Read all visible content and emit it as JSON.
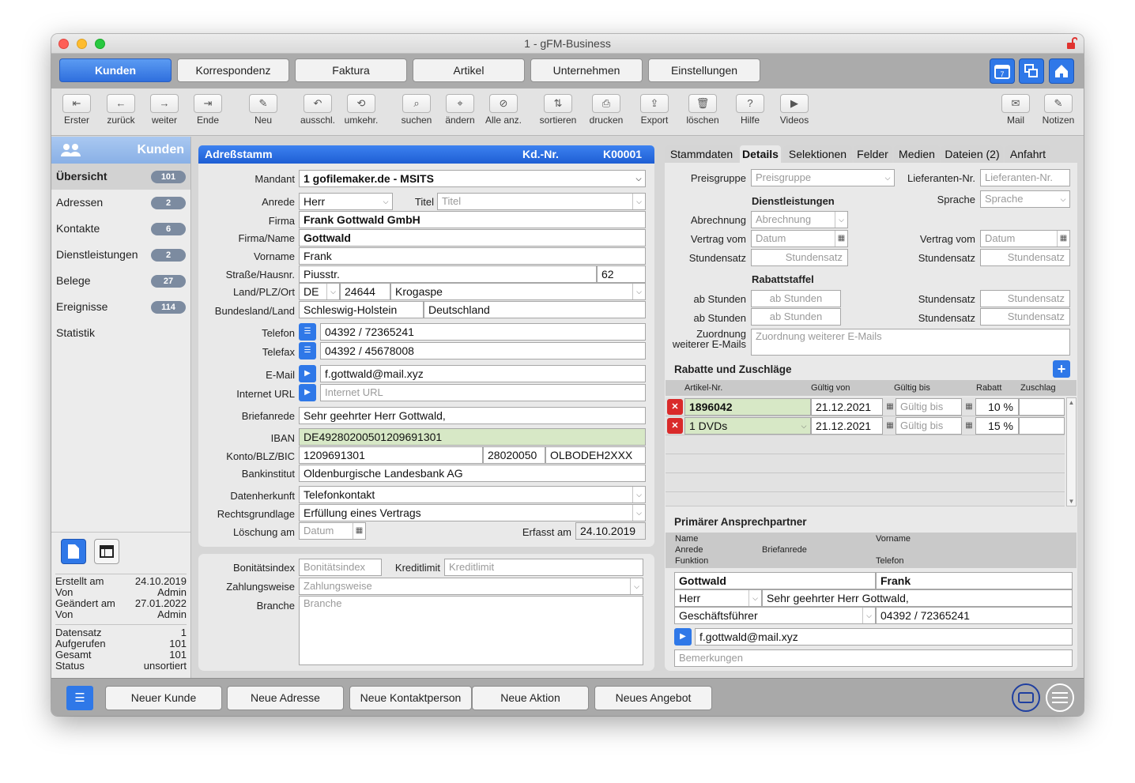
{
  "window": {
    "title": "1 - gFM-Business"
  },
  "nav": {
    "tabs": [
      "Kunden",
      "Korrespondenz",
      "Faktura",
      "Artikel",
      "Unternehmen",
      "Einstellungen"
    ],
    "icons": [
      "calendar-icon",
      "windows-icon",
      "home-icon"
    ],
    "calendar_day": "7"
  },
  "toolbar": {
    "left": [
      {
        "label": "Erster",
        "glyph": "⇤"
      },
      {
        "label": "zurück",
        "glyph": "←"
      },
      {
        "label": "weiter",
        "glyph": "→"
      },
      {
        "label": "Ende",
        "glyph": "⇥"
      },
      {
        "label": "Neu",
        "glyph": "✎"
      },
      {
        "label": "ausschl.",
        "glyph": "↶"
      },
      {
        "label": "umkehr.",
        "glyph": "⟲"
      },
      {
        "label": "suchen",
        "glyph": "⌕"
      },
      {
        "label": "ändern",
        "glyph": "⌖"
      },
      {
        "label": "Alle anz.",
        "glyph": "⊘"
      },
      {
        "label": "sortieren",
        "glyph": "⇅"
      },
      {
        "label": "drucken",
        "glyph": "⎙"
      },
      {
        "label": "Export",
        "glyph": "⇪"
      },
      {
        "label": "löschen",
        "glyph": "🗑"
      },
      {
        "label": "Hilfe",
        "glyph": "?"
      },
      {
        "label": "Videos",
        "glyph": "▶"
      }
    ],
    "right": [
      {
        "label": "Mail",
        "glyph": "✉"
      },
      {
        "label": "Notizen",
        "glyph": "✎"
      }
    ]
  },
  "sidebar": {
    "title": "Kunden",
    "items": [
      {
        "label": "Übersicht",
        "count": "101"
      },
      {
        "label": "Adressen",
        "count": "2"
      },
      {
        "label": "Kontakte",
        "count": "6"
      },
      {
        "label": "Dienstleistungen",
        "count": "2"
      },
      {
        "label": "Belege",
        "count": "27"
      },
      {
        "label": "Ereignisse",
        "count": "114"
      },
      {
        "label": "Statistik",
        "count": ""
      }
    ],
    "meta1": [
      {
        "k": "Erstellt am",
        "v": "24.10.2019"
      },
      {
        "k": "Von",
        "v": "Admin"
      },
      {
        "k": "Geändert am",
        "v": "27.01.2022"
      },
      {
        "k": "Von",
        "v": "Admin"
      }
    ],
    "meta2": [
      {
        "k": "Datensatz",
        "v": "1"
      },
      {
        "k": "Aufgerufen",
        "v": "101"
      },
      {
        "k": "Gesamt",
        "v": "101"
      },
      {
        "k": "Status",
        "v": "unsortiert"
      }
    ]
  },
  "adress": {
    "header": {
      "title": "Adreßstamm",
      "kdnr_label": "Kd.-Nr.",
      "kdnr": "K00001"
    },
    "labels": {
      "mandant": "Mandant",
      "anrede": "Anrede",
      "titel": "Titel",
      "firma": "Firma",
      "firmaname": "Firma/Name",
      "vorname": "Vorname",
      "strasse": "Straße/Hausnr.",
      "land": "Land/PLZ/Ort",
      "bundesland": "Bundesland/Land",
      "telefon": "Telefon",
      "telefax": "Telefax",
      "email": "E-Mail",
      "url": "Internet URL",
      "briefanrede": "Briefanrede",
      "iban": "IBAN",
      "konto": "Konto/BLZ/BIC",
      "bank": "Bankinstitut",
      "herkunft": "Datenherkunft",
      "rechts": "Rechtsgrundlage",
      "loeschung": "Löschung am",
      "erfasst": "Erfasst am"
    },
    "values": {
      "mandant": "1 gofilemaker.de - MSITS",
      "anrede": "Herr",
      "titel_ph": "Titel",
      "firma": "Frank Gottwald GmbH",
      "firmaname": "Gottwald",
      "vorname": "Frank",
      "strasse": "Piusstr.",
      "hausnr": "62",
      "land": "DE",
      "plz": "24644",
      "ort": "Krogaspe",
      "bundesland": "Schleswig-Holstein",
      "staat": "Deutschland",
      "telefon": "04392 / 72365241",
      "telefax": "04392 / 45678008",
      "email": "f.gottwald@mail.xyz",
      "url_ph": "Internet URL",
      "briefanrede": "Sehr geehrter Herr Gottwald,",
      "iban": "DE49280200501209691301",
      "konto": "1209691301",
      "blz": "28020050",
      "bic": "OLBODEH2XXX",
      "bank": "Oldenburgische Landesbank AG",
      "herkunft": "Telefonkontakt",
      "rechts": "Erfüllung eines Vertrags",
      "loeschung_ph": "Datum",
      "erfasst": "24.10.2019"
    }
  },
  "extra": {
    "labels": {
      "bonitaet": "Bonitätsindex",
      "kredit": "Kreditlimit",
      "zahlung": "Zahlungsweise",
      "branche": "Branche"
    },
    "ph": {
      "bonitaet": "Bonitätsindex",
      "kredit": "Kreditlimit",
      "zahlung": "Zahlungsweise",
      "branche": "Branche"
    }
  },
  "tabs": [
    "Stammdaten",
    "Details",
    "Selektionen",
    "Felder",
    "Medien",
    "Dateien (2)",
    "Anfahrt"
  ],
  "details": {
    "preisgruppe_label": "Preisgruppe",
    "preisgruppe_ph": "Preisgruppe",
    "lieferanten_label": "Lieferanten-Nr.",
    "lieferanten_ph": "Lieferanten-Nr.",
    "sprache_label": "Sprache",
    "sprache_ph": "Sprache",
    "dienst_title": "Dienstleistungen",
    "abrechnung_label": "Abrechnung",
    "abrechnung_ph": "Abrechnung",
    "vertrag_label": "Vertrag vom",
    "datum_ph": "Datum",
    "stundensatz_label": "Stundensatz",
    "stundensatz_ph": "Stundensatz",
    "rabatt_title": "Rabattstaffel",
    "abstunden_label": "ab Stunden",
    "abstunden_ph": "ab Stunden",
    "zuordnung_label1": "Zuordnung",
    "zuordnung_label2": "weiterer E-Mails",
    "zuordnung_ph": "Zuordnung weiterer E-Mails"
  },
  "rabatte": {
    "title": "Rabatte und Zuschläge",
    "headers": [
      "Artikel-Nr.",
      "Gültig von",
      "Gültig bis",
      "Rabatt",
      "Zuschlag"
    ],
    "rows": [
      {
        "artikel": "1896042",
        "von": "21.12.2021",
        "bis_ph": "Gültig bis",
        "rabatt": "10 %",
        "zuschlag": ""
      },
      {
        "artikel": "1 DVDs",
        "von": "21.12.2021",
        "bis_ph": "Gültig bis",
        "rabatt": "15 %",
        "zuschlag": ""
      }
    ]
  },
  "ansprech": {
    "title": "Primärer Ansprechpartner",
    "h_name": "Name",
    "h_vorname": "Vorname",
    "h_anrede": "Anrede",
    "h_brief": "Briefanrede",
    "h_funktion": "Funktion",
    "h_telefon": "Telefon",
    "name": "Gottwald",
    "vorname": "Frank",
    "anrede": "Herr",
    "briefanrede": "Sehr geehrter Herr Gottwald,",
    "funktion": "Geschäftsführer",
    "telefon": "04392 / 72365241",
    "email": "f.gottwald@mail.xyz",
    "bemerkungen_ph": "Bemerkungen"
  },
  "bottom": {
    "buttons": [
      "Neuer Kunde",
      "Neue Adresse",
      "Neue Kontaktperson",
      "Neue Aktion",
      "Neues Angebot"
    ]
  },
  "colors": {
    "accent": "#2f78e8",
    "header_blue": "#1e5ed4",
    "delete_red": "#d92a2a",
    "green_field": "#d7e8c6"
  }
}
